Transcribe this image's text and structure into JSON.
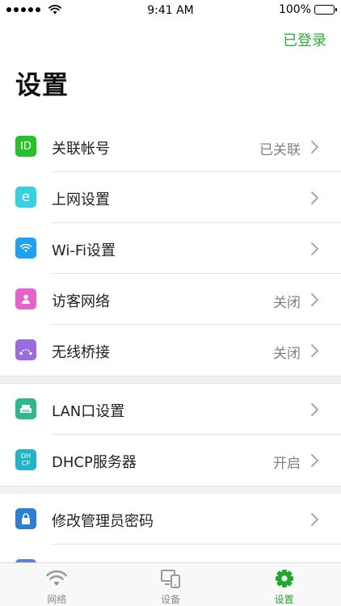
{
  "status_bar": {
    "time": "9:41 AM",
    "battery": "100%"
  },
  "header": {
    "login_status": "已登录",
    "title": "设置"
  },
  "colors": {
    "accent": "#1faa2e",
    "login": "#27b637"
  },
  "groups": [
    {
      "items": [
        {
          "icon": "id-icon",
          "icon_text": "ID",
          "icon_color": "#27c22a",
          "label": "关联帐号",
          "value": "已关联"
        },
        {
          "icon": "internet-icon",
          "icon_text": "e",
          "icon_color": "#36cfe3",
          "label": "上网设置",
          "value": ""
        },
        {
          "icon": "wifi-icon",
          "icon_text": "",
          "icon_color": "#1ea1f0",
          "label": "Wi-Fi设置",
          "value": ""
        },
        {
          "icon": "guest-icon",
          "icon_text": "",
          "icon_color": "#e962c9",
          "label": "访客网络",
          "value": "关闭"
        },
        {
          "icon": "bridge-icon",
          "icon_text": "",
          "icon_color": "#9b6be2",
          "label": "无线桥接",
          "value": "关闭"
        }
      ]
    },
    {
      "items": [
        {
          "icon": "lan-icon",
          "icon_text": "",
          "icon_color": "#2fb88a",
          "label": "LAN口设置",
          "value": ""
        },
        {
          "icon": "dhcp-icon",
          "icon_text": "DH CP",
          "icon_color": "#22b3c9",
          "label": "DHCP服务器",
          "value": "开启"
        }
      ]
    },
    {
      "items": [
        {
          "icon": "lock-icon",
          "icon_text": "",
          "icon_color": "#2c7ed6",
          "label": "修改管理员密码",
          "value": ""
        }
      ]
    }
  ],
  "tabs": [
    {
      "label": "网络",
      "icon": "network-icon",
      "active": false
    },
    {
      "label": "设备",
      "icon": "devices-icon",
      "active": false
    },
    {
      "label": "设置",
      "icon": "gear-icon",
      "active": true
    }
  ]
}
